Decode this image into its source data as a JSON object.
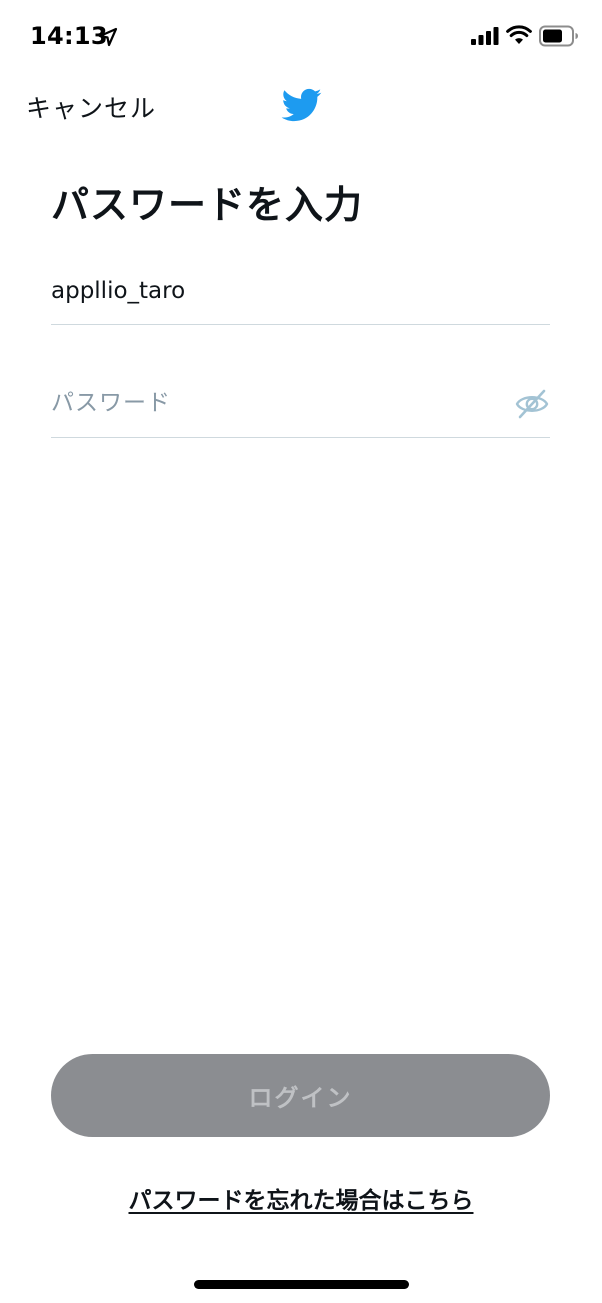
{
  "status_bar": {
    "time": "14:13",
    "icons": [
      "location-arrow-icon",
      "signal-icon",
      "wifi-icon",
      "battery-icon"
    ]
  },
  "nav": {
    "cancel_label": "キャンセル",
    "logo_icon": "twitter-bird-icon"
  },
  "title": "パスワードを入力",
  "username": {
    "value": "appllio_taro"
  },
  "password": {
    "placeholder": "パスワード",
    "toggle_icon": "eye-off-icon"
  },
  "login_label": "ログイン",
  "forgot_link": "パスワードを忘れた場合はこちら",
  "colors": {
    "brand": "#1d9bf0",
    "text": "#0f1419",
    "placeholder": "#8899a6",
    "divider": "#cfd9de",
    "button_disabled_bg": "#8b8d91",
    "button_disabled_text": "#bfc1c4"
  }
}
